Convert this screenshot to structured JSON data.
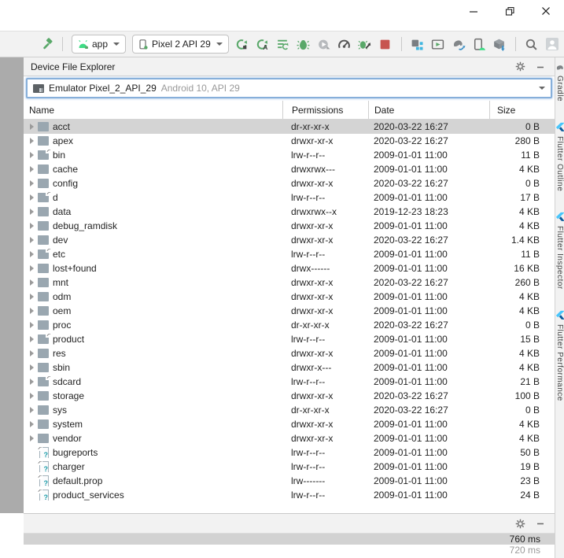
{
  "toolbar": {
    "run_config_label": "app",
    "device_label": "Pixel 2 API 29"
  },
  "explorer": {
    "title": "Device File Explorer",
    "device": {
      "name": "Emulator Pixel_2_API_29",
      "details": "Android 10, API 29"
    },
    "columns": {
      "name": "Name",
      "permissions": "Permissions",
      "date": "Date",
      "size": "Size"
    },
    "rows": [
      {
        "name": "acct",
        "type": "folder",
        "permissions": "dr-xr-xr-x",
        "date": "2020-03-22 16:27",
        "size": "0 B",
        "selected": true
      },
      {
        "name": "apex",
        "type": "folder",
        "permissions": "drwxr-xr-x",
        "date": "2020-03-22 16:27",
        "size": "280 B",
        "selected": false
      },
      {
        "name": "bin",
        "type": "folder-link",
        "permissions": "lrw-r--r--",
        "date": "2009-01-01 11:00",
        "size": "11 B",
        "selected": false
      },
      {
        "name": "cache",
        "type": "folder",
        "permissions": "drwxrwx---",
        "date": "2009-01-01 11:00",
        "size": "4 KB",
        "selected": false
      },
      {
        "name": "config",
        "type": "folder",
        "permissions": "drwxr-xr-x",
        "date": "2020-03-22 16:27",
        "size": "0 B",
        "selected": false
      },
      {
        "name": "d",
        "type": "folder-link",
        "permissions": "lrw-r--r--",
        "date": "2009-01-01 11:00",
        "size": "17 B",
        "selected": false
      },
      {
        "name": "data",
        "type": "folder",
        "permissions": "drwxrwx--x",
        "date": "2019-12-23 18:23",
        "size": "4 KB",
        "selected": false
      },
      {
        "name": "debug_ramdisk",
        "type": "folder",
        "permissions": "drwxr-xr-x",
        "date": "2009-01-01 11:00",
        "size": "4 KB",
        "selected": false
      },
      {
        "name": "dev",
        "type": "folder",
        "permissions": "drwxr-xr-x",
        "date": "2020-03-22 16:27",
        "size": "1.4 KB",
        "selected": false
      },
      {
        "name": "etc",
        "type": "folder-link",
        "permissions": "lrw-r--r--",
        "date": "2009-01-01 11:00",
        "size": "11 B",
        "selected": false
      },
      {
        "name": "lost+found",
        "type": "folder",
        "permissions": "drwx------",
        "date": "2009-01-01 11:00",
        "size": "16 KB",
        "selected": false
      },
      {
        "name": "mnt",
        "type": "folder",
        "permissions": "drwxr-xr-x",
        "date": "2020-03-22 16:27",
        "size": "260 B",
        "selected": false
      },
      {
        "name": "odm",
        "type": "folder",
        "permissions": "drwxr-xr-x",
        "date": "2009-01-01 11:00",
        "size": "4 KB",
        "selected": false
      },
      {
        "name": "oem",
        "type": "folder",
        "permissions": "drwxr-xr-x",
        "date": "2009-01-01 11:00",
        "size": "4 KB",
        "selected": false
      },
      {
        "name": "proc",
        "type": "folder",
        "permissions": "dr-xr-xr-x",
        "date": "2020-03-22 16:27",
        "size": "0 B",
        "selected": false
      },
      {
        "name": "product",
        "type": "folder-link",
        "permissions": "lrw-r--r--",
        "date": "2009-01-01 11:00",
        "size": "15 B",
        "selected": false
      },
      {
        "name": "res",
        "type": "folder",
        "permissions": "drwxr-xr-x",
        "date": "2009-01-01 11:00",
        "size": "4 KB",
        "selected": false
      },
      {
        "name": "sbin",
        "type": "folder",
        "permissions": "drwxr-x---",
        "date": "2009-01-01 11:00",
        "size": "4 KB",
        "selected": false
      },
      {
        "name": "sdcard",
        "type": "folder-link",
        "permissions": "lrw-r--r--",
        "date": "2009-01-01 11:00",
        "size": "21 B",
        "selected": false
      },
      {
        "name": "storage",
        "type": "folder",
        "permissions": "drwxr-xr-x",
        "date": "2020-03-22 16:27",
        "size": "100 B",
        "selected": false
      },
      {
        "name": "sys",
        "type": "folder",
        "permissions": "dr-xr-xr-x",
        "date": "2020-03-22 16:27",
        "size": "0 B",
        "selected": false
      },
      {
        "name": "system",
        "type": "folder",
        "permissions": "drwxr-xr-x",
        "date": "2009-01-01 11:00",
        "size": "4 KB",
        "selected": false
      },
      {
        "name": "vendor",
        "type": "folder",
        "permissions": "drwxr-xr-x",
        "date": "2009-01-01 11:00",
        "size": "4 KB",
        "selected": false
      },
      {
        "name": "bugreports",
        "type": "file-link",
        "permissions": "lrw-r--r--",
        "date": "2009-01-01 11:00",
        "size": "50 B",
        "selected": false
      },
      {
        "name": "charger",
        "type": "file-link",
        "permissions": "lrw-r--r--",
        "date": "2009-01-01 11:00",
        "size": "19 B",
        "selected": false
      },
      {
        "name": "default.prop",
        "type": "file-link",
        "permissions": "lrw-------",
        "date": "2009-01-01 11:00",
        "size": "23 B",
        "selected": false
      },
      {
        "name": "product_services",
        "type": "file-link",
        "permissions": "lrw-r--r--",
        "date": "2009-01-01 11:00",
        "size": "24 B",
        "selected": false
      }
    ]
  },
  "stripe": {
    "tabs": [
      {
        "icon": "gradle-elephant-icon",
        "label": "Gradle"
      },
      {
        "icon": "flutter-icon",
        "label": "Flutter Outline"
      },
      {
        "icon": "flutter-icon",
        "label": "Flutter Inspector"
      },
      {
        "icon": "flutter-icon",
        "label": "Flutter Performance"
      }
    ]
  },
  "bottom": {
    "rows": [
      {
        "value": "760 ms",
        "selected": true
      },
      {
        "value": "720 ms",
        "selected": false
      }
    ]
  },
  "colors": {
    "accent_green": "#59a869",
    "stop_red": "#c75450",
    "focus_blue": "#87afda",
    "selection_gray": "#d4d4d4",
    "folder_gray_blue": "#9aa7b0",
    "flutter_blue": "#47c5fb"
  }
}
